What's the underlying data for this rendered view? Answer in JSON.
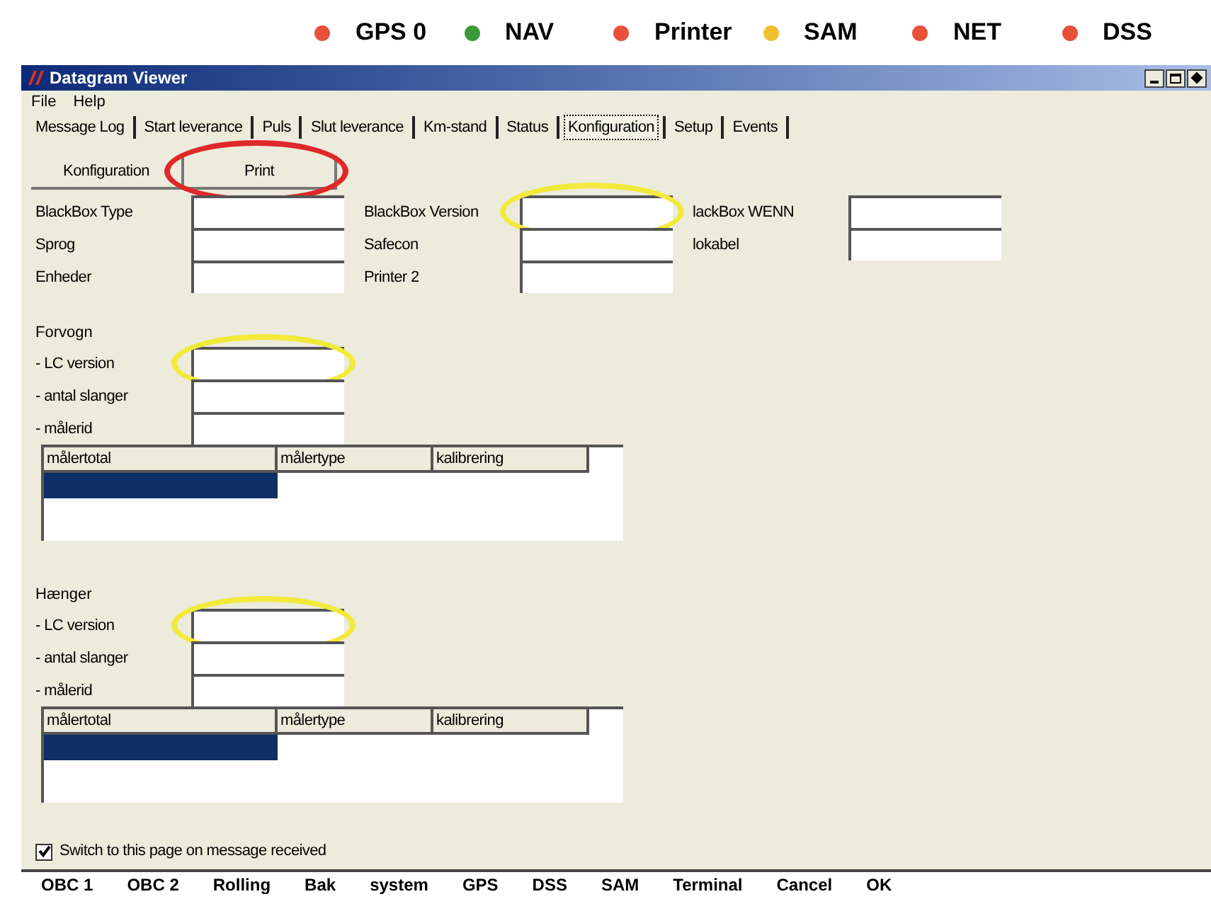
{
  "status": [
    {
      "label": "GPS 0",
      "color": "#e8503a"
    },
    {
      "label": "NAV",
      "color": "#3a9a3a"
    },
    {
      "label": "Printer",
      "color": "#e8503a"
    },
    {
      "label": "SAM",
      "color": "#f0c030"
    },
    {
      "label": "NET",
      "color": "#e8503a"
    },
    {
      "label": "DSS",
      "color": "#e8503a"
    }
  ],
  "window": {
    "title": "Datagram Viewer"
  },
  "menu": [
    "File",
    "Help"
  ],
  "tabs": [
    {
      "label": "Message Log",
      "selected": false
    },
    {
      "label": "Start leverance",
      "selected": false
    },
    {
      "label": "Puls",
      "selected": false
    },
    {
      "label": "Slut leverance",
      "selected": false
    },
    {
      "label": "Km-stand",
      "selected": false
    },
    {
      "label": "Status",
      "selected": false
    },
    {
      "label": "Konfiguration",
      "selected": true
    },
    {
      "label": "Setup",
      "selected": false
    },
    {
      "label": "Events",
      "selected": false
    }
  ],
  "buttons": [
    {
      "label": "Konfiguration",
      "circled": false
    },
    {
      "label": "Print",
      "circled": true
    }
  ],
  "field_columns": [
    [
      {
        "label": "BlackBox Type",
        "circled": false
      },
      {
        "label": "Sprog",
        "circled": false
      },
      {
        "label": "Enheder",
        "circled": false
      }
    ],
    [
      {
        "label": "BlackBox Version",
        "circled": true
      },
      {
        "label": "Safecon",
        "circled": false
      },
      {
        "label": "Printer 2",
        "circled": false
      }
    ],
    [
      {
        "label": "lackBox WENN",
        "circled": false
      },
      {
        "label": "lokabel",
        "circled": false
      }
    ]
  ],
  "sections": [
    {
      "title": "Forvogn",
      "fields": [
        {
          "label": "- LC version",
          "circled": true
        },
        {
          "label": "- antal slanger",
          "circled": false
        },
        {
          "label": "- målerid",
          "circled": false
        }
      ],
      "table": {
        "columns": [
          "målertotal",
          "målertype",
          "kalibrering"
        ],
        "rows": [
          {
            "selected": true
          }
        ]
      }
    },
    {
      "title": "Hænger",
      "fields": [
        {
          "label": "- LC version",
          "circled": true
        },
        {
          "label": "- antal slanger",
          "circled": false
        },
        {
          "label": "- målerid",
          "circled": false
        }
      ],
      "table": {
        "columns": [
          "målertotal",
          "målertype",
          "kalibrering"
        ],
        "rows": [
          {
            "selected": true
          }
        ]
      }
    }
  ],
  "checkbox": {
    "label": "Switch to this page on message received",
    "checked": true
  },
  "bottom_buttons": [
    "OBC 1",
    "OBC 2",
    "Rolling",
    "Bak",
    "system",
    "GPS",
    "DSS",
    "SAM",
    "Terminal",
    "Cancel",
    "OK"
  ]
}
